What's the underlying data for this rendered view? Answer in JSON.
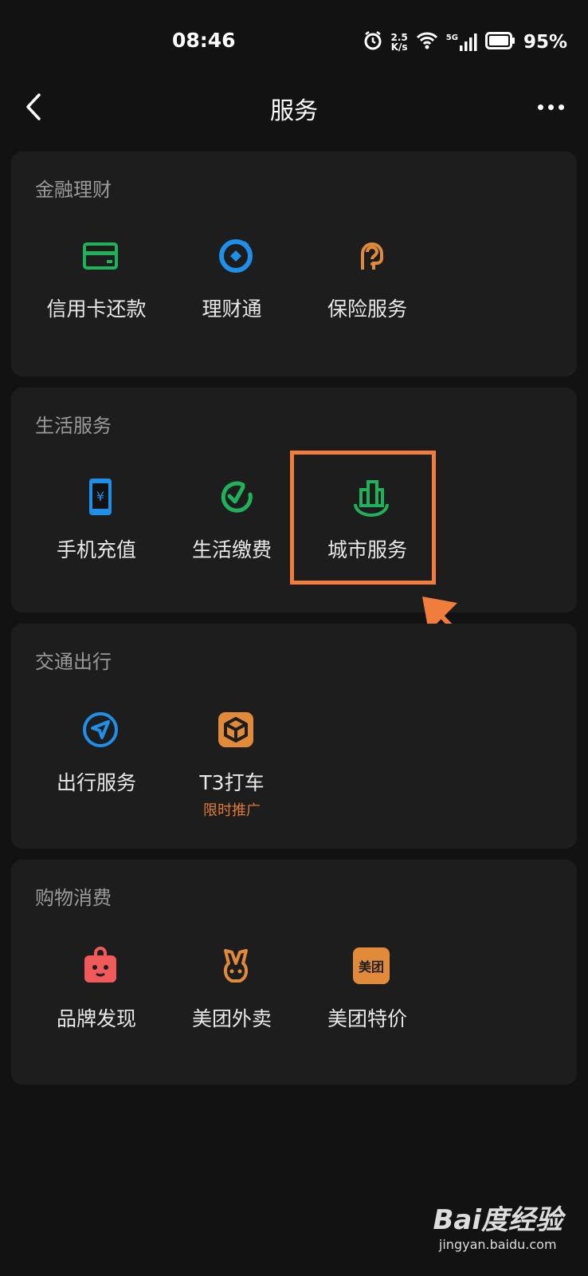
{
  "status_bar": {
    "time": "08:46",
    "net_speed_value": "2.5",
    "net_speed_unit": "K/s",
    "network": "5G",
    "battery": "95%"
  },
  "header": {
    "title": "服务"
  },
  "sections": [
    {
      "title": "金融理财",
      "items": [
        {
          "label": "信用卡还款",
          "icon": "credit-card-icon"
        },
        {
          "label": "理财通",
          "icon": "wealth-icon"
        },
        {
          "label": "保险服务",
          "icon": "insurance-icon"
        }
      ]
    },
    {
      "title": "生活服务",
      "items": [
        {
          "label": "手机充值",
          "icon": "phone-topup-icon"
        },
        {
          "label": "生活缴费",
          "icon": "utility-payment-icon"
        },
        {
          "label": "城市服务",
          "icon": "city-services-icon"
        }
      ]
    },
    {
      "title": "交通出行",
      "items": [
        {
          "label": "出行服务",
          "icon": "travel-icon"
        },
        {
          "label": "T3打车",
          "sub": "限时推广",
          "icon": "t3-taxi-icon"
        }
      ]
    },
    {
      "title": "购物消费",
      "items": [
        {
          "label": "品牌发现",
          "icon": "brand-discovery-icon"
        },
        {
          "label": "美团外卖",
          "icon": "meituan-delivery-icon"
        },
        {
          "label": "美团特价",
          "icon": "meituan-deals-icon",
          "icon_text": "美团"
        }
      ]
    }
  ],
  "watermark": {
    "brand": "Bai度经验",
    "url": "jingyan.baidu.com"
  },
  "colors": {
    "accent_green": "#1fb25a",
    "accent_blue": "#1f8fe8",
    "accent_orange": "#e08a3a",
    "highlight": "#f07d3c"
  }
}
